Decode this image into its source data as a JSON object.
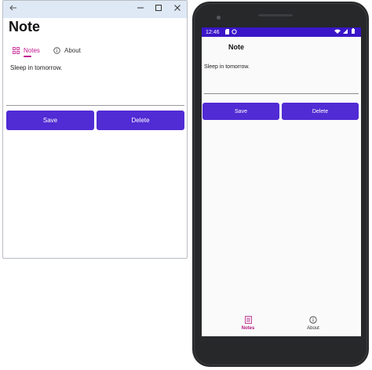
{
  "windows_app": {
    "title": "Note",
    "tabs": [
      {
        "label": "Notes",
        "icon": "notes-icon",
        "active": true
      },
      {
        "label": "About",
        "icon": "info-icon",
        "active": false
      }
    ],
    "editor_text": "Sleep in tomorrow.",
    "save_label": "Save",
    "delete_label": "Delete",
    "title_controls": {
      "back": "back-arrow-icon",
      "minimize": "minimize-icon",
      "maximize": "maximize-icon",
      "close": "close-icon"
    }
  },
  "android_app": {
    "status_time": "12:46",
    "title": "Note",
    "editor_text": "Sleep in tomorrow.",
    "save_label": "Save",
    "delete_label": "Delete",
    "tabs": [
      {
        "label": "Notes",
        "icon": "notes-icon",
        "active": true
      },
      {
        "label": "About",
        "icon": "info-icon",
        "active": false
      }
    ]
  },
  "colors": {
    "accent": "#512bd4",
    "status_bar": "#3a16c8",
    "tab_active": "#c1168f",
    "title_bar": "#dfe9f6"
  }
}
